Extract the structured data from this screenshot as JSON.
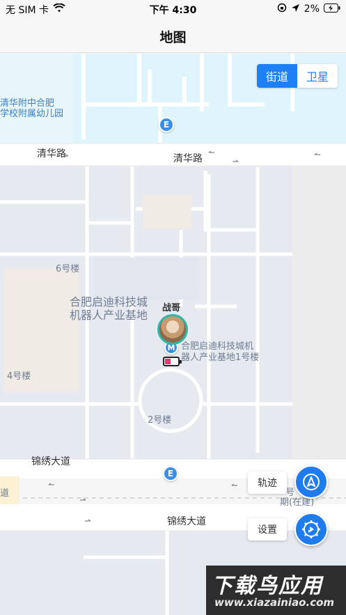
{
  "status_bar": {
    "carrier": "无 SIM 卡",
    "time": "下午 4:30",
    "battery_pct": "2%"
  },
  "nav": {
    "title": "地图"
  },
  "map_toggle": {
    "street": "街道",
    "satellite": "卫星",
    "active": "street"
  },
  "map_labels": {
    "kindergarten_line1": "清华附中合肥",
    "kindergarten_line2": "学校附属幼儿园",
    "road_qinghua_left": "清华路",
    "road_qinghua_right": "清华路",
    "bldg6": "6号楼",
    "bldg4": "4号楼",
    "bldg2": "2号楼",
    "park_line1": "合肥启迪科技城",
    "park_line2": "机器人产业基地",
    "bldg1_line1": "合肥启迪科技城机",
    "bldg1_line2": "器人产业基地1号楼",
    "road_jinxiu_upper": "锦绣大道",
    "road_jinxiu_lower": "锦绣大道",
    "edge_left": "道",
    "construction_line1": "号",
    "construction_line2": "期(在建)"
  },
  "device": {
    "name": "战哥",
    "battery_level": 0.4
  },
  "buttons": {
    "track": "轨迹",
    "settings": "设置"
  },
  "watermark": {
    "brand": "下载鸟应用",
    "domain": "www.xiazainiao.com"
  },
  "colors": {
    "accent": "#1e80f5",
    "map_block": "#e6e9ef",
    "road": "#ffffff",
    "water_area": "#dff5fb"
  },
  "icons": {
    "wifi": "wifi-icon",
    "location": "location-arrow-icon",
    "battery": "battery-charging-icon",
    "navigate": "navigation-arrow-icon",
    "settings": "gear-icon"
  }
}
